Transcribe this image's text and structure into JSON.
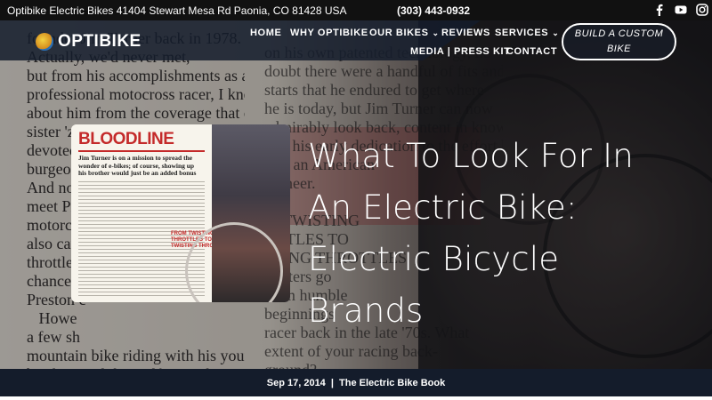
{
  "topbar": {
    "address": "Optibike Electric Bikes 41404 Stewart Mesa Rd Paonia, CO 81428 USA",
    "phone": "(303) 443-0932",
    "social_icons": [
      "facebook-icon",
      "youtube-icon",
      "instagram-icon"
    ]
  },
  "header": {
    "logo_text": "OPTIBIKE",
    "nav": [
      {
        "label": "HOME",
        "has_dropdown": false
      },
      {
        "label": "WHY OPTIBIKE",
        "has_dropdown": false
      },
      {
        "label": "OUR BIKES",
        "has_dropdown": true
      },
      {
        "label": "REVIEWS",
        "has_dropdown": false
      },
      {
        "label": "SERVICES",
        "has_dropdown": true
      },
      {
        "label": "MEDIA | PRESS KIT",
        "has_dropdown": false
      },
      {
        "label": "CONTACT",
        "has_dropdown": false
      }
    ],
    "cta_label": "BUILD A CUSTOM BIKE"
  },
  "hero": {
    "background_text_left": "founder Jim Turner back in 1978.\nActually, we'd never met,\nbut from his accomplishments as a\nprofessional motocross racer, I knew all\nabout him from the coverage that our\nsister 'zi\ndevoted\nburgeoni\nAnd not\nmeet Pre\nmotorcyc\nalso cam\nthrottle-t\nchance t\nPreston c\n   Howe\na few sh\nmountain bike riding with his younger\nbrother Paul, himself quite the pioneer in\nthe world of bicycle technology. In fact,\nI even remember being somewhat dismis-\nsive of Jim back in the mid-'90s when I",
    "background_text_right": "on his own patented technology, no\ndoubt there were a handful of fits and\nstarts that he endured to get where\nhe is today, but Jim Turner can now\nadmirably look back, content in knowing\nthat his early dedication to the effort has\nhim an American\npioneer.\n\nM TWISTING\nOTTLES TO\nSTING THROTTLES\nmatters go\nfrom humble\nbeginnings\nracer back in the late '70s. What\nextent of your racing back-\nground?\n                  ruz,\nCalifornia, which was surrounded by a\nlot of undeveloped land back then. Like\na lot of kids, we got some mini bikes,\nrode all around and then started racing.\nMy dad would have nothing to do with",
    "title": "What To Look For In An Electric Bike: Electric Bicycle Brands"
  },
  "thumbnail": {
    "heading": "BLOODLINE",
    "subheading": "Jim Turner is on a mission to spread the\nwonder of e-bikes; of course, showing up\nhis brother would just be an added bonus",
    "pullquote": "FROM TWISTING\nTHROTTLES TO\nTWISTING THROTTLES"
  },
  "meta": {
    "date": "Sep 17, 2014",
    "separator": "|",
    "category": "The Electric Bike Book"
  },
  "colors": {
    "nav_bg": "#141c2b",
    "magazine_red": "#c42a2a",
    "white": "#ffffff"
  }
}
